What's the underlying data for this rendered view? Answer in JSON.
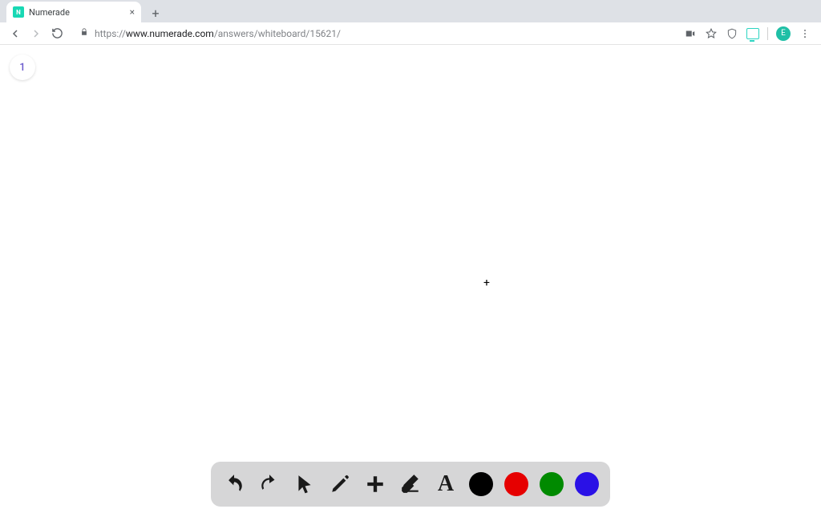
{
  "browser": {
    "tab_title": "Numerade",
    "favicon_letter": "N",
    "url_prefix": "https://",
    "url_bold": "www.numerade.com",
    "url_rest": "/answers/whiteboard/15621/",
    "avatar_letter": "E"
  },
  "whiteboard": {
    "slide_number": "1"
  },
  "toolbar": {
    "undo": "undo",
    "redo": "redo",
    "pointer": "pointer",
    "pencil": "pencil",
    "add": "add",
    "eraser": "eraser",
    "text_label": "A",
    "colors": {
      "black": "#000000",
      "red": "#e60000",
      "green": "#008a00",
      "blue": "#2a11e6"
    }
  }
}
